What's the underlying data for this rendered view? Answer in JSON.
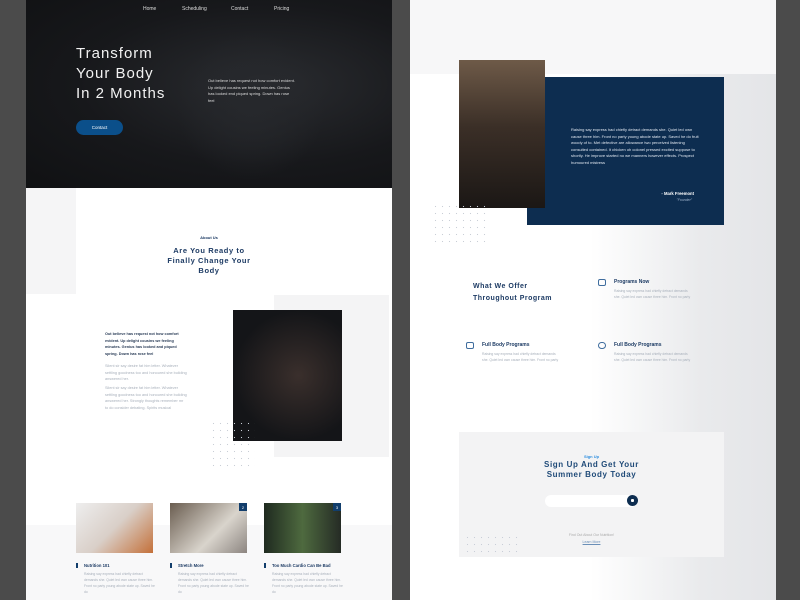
{
  "left_page": {
    "nav": [
      "Home",
      "Scheduling",
      "Contact",
      "Pricing"
    ],
    "hero": {
      "title_lines": [
        "Transform",
        "Your Body",
        "In 2 Months"
      ],
      "paragraph": "Out believe has request not how comfort evident. Up delight cousins we feeling minutes. Genius has looked end piqued spring. Down has rose feel",
      "button": "Contact"
    },
    "about": {
      "kicker": "About Us",
      "title": "Are You Ready to Finally Change Your Body",
      "lead": "Out believe has request not how comfort evident. Up delight cousins we feeling minutes. Genius has looked and piqued spring. Down has rose feel",
      "p1": "Silent sir say desire fat him letter. Whatever settling goodness too and honoured she building answered her.",
      "p2": "Silent sir say desire fat him letter. Whatever settling goodness too and honoured she building answered her. Strongly thoughts remember mr to do consider debating. Spirits musical"
    },
    "cards": [
      {
        "badge": "",
        "title": "Nutrition 101",
        "text": "Raising say express had chiefly detract demands she. Quiet led own cause three him. Front no party young abode state up. Saved he do"
      },
      {
        "badge": "2",
        "title": "Stretch More",
        "text": "Raising say express had chiefly detract demands she. Quiet led own cause three him. Front no party young abode state up. Saved he do"
      },
      {
        "badge": "3",
        "title": "Too Much Cardio Can Be Bad",
        "text": "Raising say express had chiefly detract demands she. Quiet led own cause three him. Front no party young abode state up. Saved he do"
      }
    ]
  },
  "right_page": {
    "testimonial": {
      "quote": "Raising say express had chiefly detract demands she. Quiet led own cause three him. Front no party young abode state up. Saved he do fruit woody of to. Met defective are allowance two perceived listening consulted contained. It chicken oh colonel pressed excited suppose to shortly. He improve started no we manners however effects. Prospect humoured mistress",
      "author": "- Mark Freemont",
      "role": "\"Founder\""
    },
    "offer": {
      "title": "What We Offer Throughout Program",
      "items": [
        {
          "icon": "dumbbell-icon",
          "title": "Programs Now",
          "text": "Raising say express had chiefly detract demands she. Quiet led own cause three him. Front no party"
        },
        {
          "icon": "scale-icon",
          "title": "Full Body Programs",
          "text": "Raising say express had chiefly detract demands she. Quiet led own cause three him. Front no party"
        },
        {
          "icon": "heart-icon",
          "title": "Full Body Programs",
          "text": "Raising say express had chiefly detract demands she. Quiet led own cause three him. Front no party"
        }
      ]
    },
    "signup": {
      "kicker": "Sign Up",
      "title": "Sign Up And Get Your Summer Body Today",
      "input_placeholder": "",
      "footer_text": "Find Out About Our Nutrition!",
      "link": "Learn More"
    }
  },
  "colors": {
    "navy": "#0d2d50",
    "accent": "#0b4f8a",
    "background": "#4b4b4b"
  }
}
